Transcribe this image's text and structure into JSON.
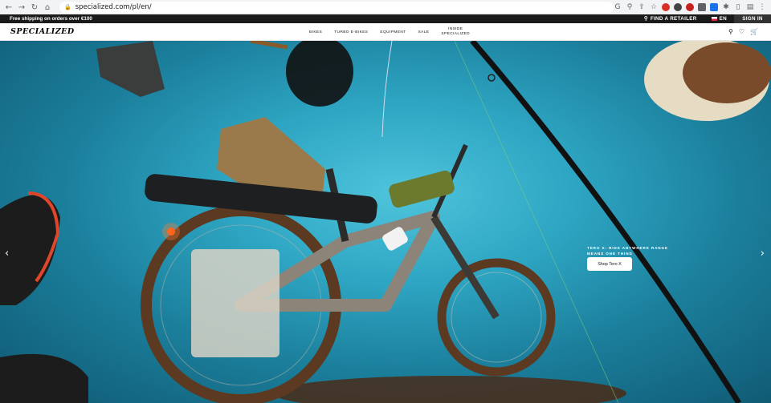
{
  "browser": {
    "url": "specialized.com/pl/en/",
    "extensions": [
      {
        "name": "g-icon",
        "glyph": "G",
        "color": ""
      },
      {
        "name": "zoom-icon",
        "glyph": "⚲",
        "color": ""
      },
      {
        "name": "share-icon",
        "glyph": "⇪",
        "color": ""
      },
      {
        "name": "bookmark-star-icon",
        "glyph": "☆",
        "color": ""
      }
    ]
  },
  "promo": {
    "shipping_text": "Free shipping on orders over €100",
    "find_retailer": "FIND A RETAILER",
    "language": "EN",
    "sign_in": "SIGN IN"
  },
  "nav": {
    "logo": "SPECIALIZED",
    "items": [
      "BIKES",
      "TURBO E-BIKES",
      "EQUIPMENT",
      "SALE"
    ],
    "inside_line1": "INSIDE",
    "inside_line2": "SPECIALIZED"
  },
  "hero": {
    "caption_line1": "TERO X: RIDE ANYWHERE RANGE",
    "caption_line2": "MEANS ONE THING",
    "cta": "Shop Tero X",
    "prev_glyph": "‹",
    "next_glyph": "›"
  },
  "colors": {
    "hero_bg": "#2ea6c3",
    "promo_bg": "#1a1a1a"
  }
}
